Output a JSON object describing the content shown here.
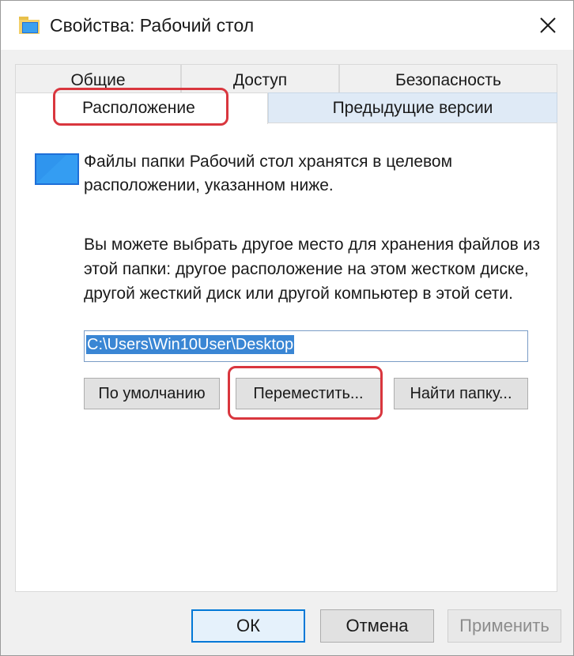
{
  "window": {
    "title": "Свойства: Рабочий стол",
    "title_icon": "folder-icon",
    "close_icon": "close-icon"
  },
  "tabs": {
    "row1": [
      {
        "label": "Общие",
        "active": false
      },
      {
        "label": "Доступ",
        "active": false
      },
      {
        "label": "Безопасность",
        "active": false
      }
    ],
    "row2": [
      {
        "label": "Расположение",
        "active": true
      },
      {
        "label": "Предыдущие версии",
        "active": false
      }
    ]
  },
  "location_tab": {
    "description": "Файлы папки Рабочий стол хранятся в целевом расположении, указанном ниже.",
    "hint": "Вы можете выбрать другое место для хранения файлов из этой папки: другое расположение на этом жестком диске, другой жесткий диск или другой компьютер в этой сети.",
    "path_value": "C:\\Users\\Win10User\\Desktop",
    "buttons": {
      "restore_default": "По умолчанию",
      "move": "Переместить...",
      "find_target": "Найти папку..."
    }
  },
  "dialog_buttons": {
    "ok": "ОК",
    "cancel": "Отмена",
    "apply": "Применить"
  },
  "colors": {
    "highlight": "#d9363e",
    "selection": "#3a86d4",
    "folder_icon": "#1e90e8",
    "previous_tab_bg": "#dfeaf6"
  }
}
